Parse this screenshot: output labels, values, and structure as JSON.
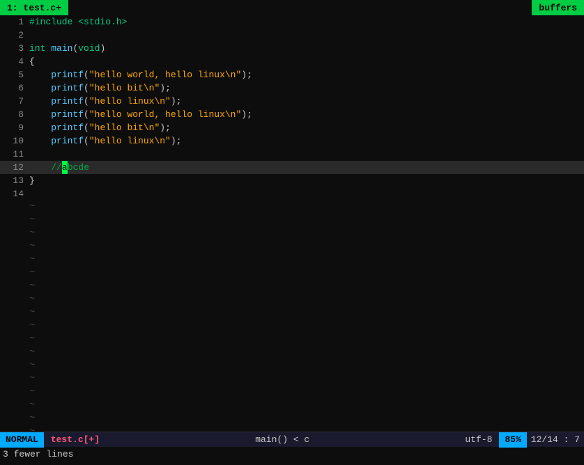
{
  "tab": {
    "filename": "1: test.c+",
    "buffers": "buffers"
  },
  "lines": [
    {
      "num": "1",
      "type": "code",
      "content": "#include <stdio.h>",
      "highlight": false
    },
    {
      "num": "2",
      "type": "empty",
      "content": "",
      "highlight": false
    },
    {
      "num": "3",
      "type": "code",
      "content": "int main(void)",
      "highlight": false
    },
    {
      "num": "4",
      "type": "code",
      "content": "{",
      "highlight": false
    },
    {
      "num": "5",
      "type": "code",
      "content": "    printf(\"hello world, hello linux\\n\");",
      "highlight": false
    },
    {
      "num": "6",
      "type": "code",
      "content": "    printf(\"hello bit\\n\");",
      "highlight": false
    },
    {
      "num": "7",
      "type": "code",
      "content": "    printf(\"hello linux\\n\");",
      "highlight": false
    },
    {
      "num": "8",
      "type": "code",
      "content": "    printf(\"hello world, hello linux\\n\");",
      "highlight": false
    },
    {
      "num": "9",
      "type": "code",
      "content": "    printf(\"hello bit\\n\");",
      "highlight": false
    },
    {
      "num": "10",
      "type": "code",
      "content": "    printf(\"hello linux\\n\");",
      "highlight": false
    },
    {
      "num": "11",
      "type": "empty",
      "content": "",
      "highlight": false
    },
    {
      "num": "12",
      "type": "cursor",
      "content": "//abcde",
      "highlight": true,
      "cursor_at": 3
    },
    {
      "num": "13",
      "type": "code",
      "content": "}",
      "highlight": false
    },
    {
      "num": "14",
      "type": "empty",
      "content": "",
      "highlight": false
    }
  ],
  "tildes": [
    "~",
    "~",
    "~",
    "~",
    "~",
    "~",
    "~",
    "~",
    "~",
    "~",
    "~",
    "~",
    "~",
    "~",
    "~",
    "~",
    "~",
    "~",
    "~"
  ],
  "status": {
    "mode": "NORMAL",
    "file": "test.c[+]",
    "func": "main() < c",
    "encoding": "utf-8",
    "percent": "85%",
    "linepos": "12/14 :  7"
  },
  "bottom_msg": "3 fewer lines"
}
